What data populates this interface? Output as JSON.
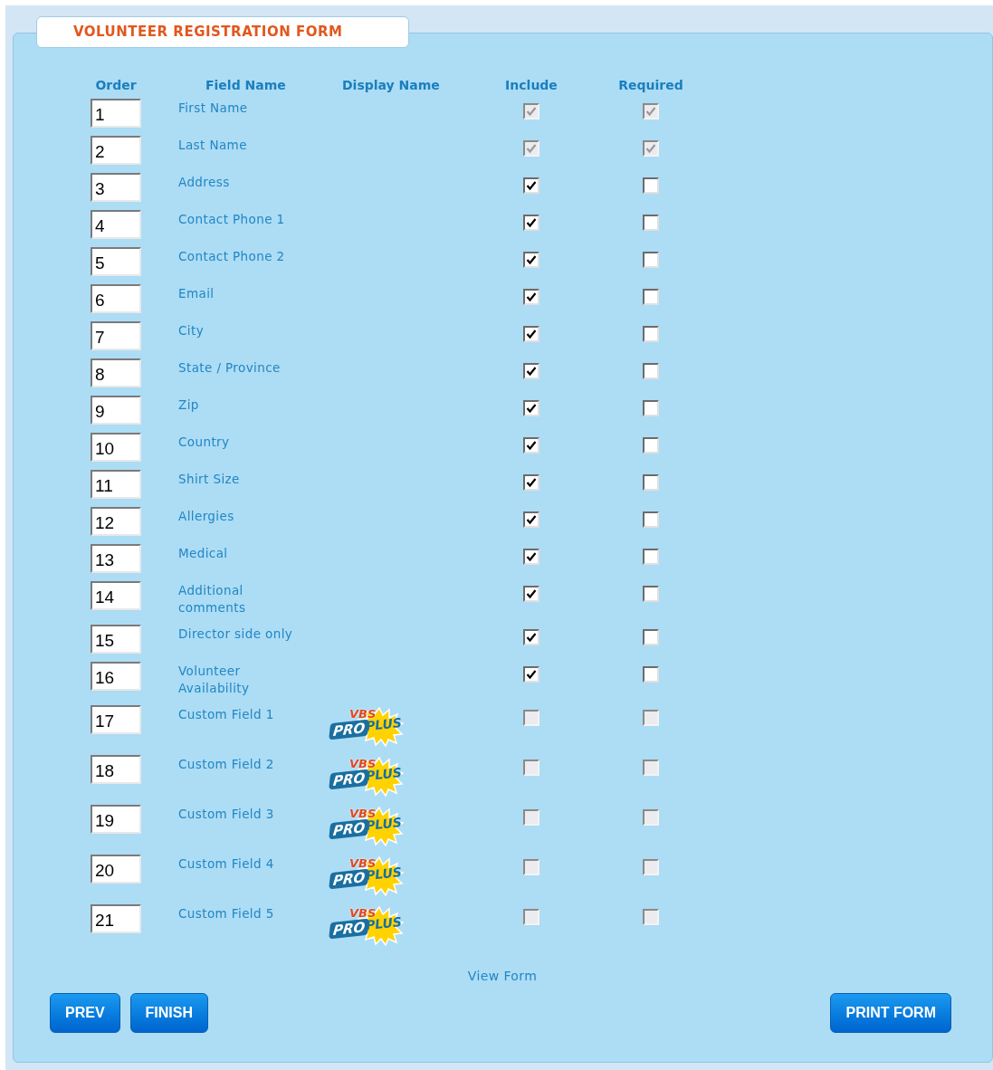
{
  "form_title": "VOLUNTEER REGISTRATION FORM",
  "columns": [
    "Order",
    "Field Name",
    "Display Name",
    "Include",
    "Required"
  ],
  "rows": [
    {
      "order": "1",
      "field_name": "First Name",
      "include_checked": true,
      "include_disabled": true,
      "required_checked": true,
      "required_disabled": true
    },
    {
      "order": "2",
      "field_name": "Last Name",
      "include_checked": true,
      "include_disabled": true,
      "required_checked": true,
      "required_disabled": true
    },
    {
      "order": "3",
      "field_name": "Address",
      "include_checked": true,
      "include_disabled": false,
      "required_checked": false,
      "required_disabled": false
    },
    {
      "order": "4",
      "field_name": "Contact Phone 1",
      "include_checked": true,
      "include_disabled": false,
      "required_checked": false,
      "required_disabled": false
    },
    {
      "order": "5",
      "field_name": "Contact Phone 2",
      "include_checked": true,
      "include_disabled": false,
      "required_checked": false,
      "required_disabled": false
    },
    {
      "order": "6",
      "field_name": "Email",
      "include_checked": true,
      "include_disabled": false,
      "required_checked": false,
      "required_disabled": false
    },
    {
      "order": "7",
      "field_name": "City",
      "include_checked": true,
      "include_disabled": false,
      "required_checked": false,
      "required_disabled": false
    },
    {
      "order": "8",
      "field_name": "State / Province",
      "include_checked": true,
      "include_disabled": false,
      "required_checked": false,
      "required_disabled": false
    },
    {
      "order": "9",
      "field_name": "Zip",
      "include_checked": true,
      "include_disabled": false,
      "required_checked": false,
      "required_disabled": false
    },
    {
      "order": "10",
      "field_name": "Country",
      "include_checked": true,
      "include_disabled": false,
      "required_checked": false,
      "required_disabled": false
    },
    {
      "order": "11",
      "field_name": "Shirt Size",
      "include_checked": true,
      "include_disabled": false,
      "required_checked": false,
      "required_disabled": false
    },
    {
      "order": "12",
      "field_name": "Allergies",
      "include_checked": true,
      "include_disabled": false,
      "required_checked": false,
      "required_disabled": false
    },
    {
      "order": "13",
      "field_name": "Medical",
      "include_checked": true,
      "include_disabled": false,
      "required_checked": false,
      "required_disabled": false
    },
    {
      "order": "14",
      "field_name": "Additional comments",
      "include_checked": true,
      "include_disabled": false,
      "required_checked": false,
      "required_disabled": false
    },
    {
      "order": "15",
      "field_name": "Director side only",
      "include_checked": true,
      "include_disabled": false,
      "required_checked": false,
      "required_disabled": false
    },
    {
      "order": "16",
      "field_name": "Volunteer Availability",
      "include_checked": true,
      "include_disabled": false,
      "required_checked": false,
      "required_disabled": false
    },
    {
      "order": "17",
      "field_name": "Custom Field 1",
      "badge": {
        "top": "VBS",
        "left": "PRO",
        "right": "PLUS"
      },
      "include_checked": false,
      "include_disabled": true,
      "required_checked": false,
      "required_disabled": true
    },
    {
      "order": "18",
      "field_name": "Custom Field 2",
      "badge": {
        "top": "VBS",
        "left": "PRO",
        "right": "PLUS"
      },
      "include_checked": false,
      "include_disabled": true,
      "required_checked": false,
      "required_disabled": true
    },
    {
      "order": "19",
      "field_name": "Custom Field 3",
      "badge": {
        "top": "VBS",
        "left": "PRO",
        "right": "PLUS"
      },
      "include_checked": false,
      "include_disabled": true,
      "required_checked": false,
      "required_disabled": true
    },
    {
      "order": "20",
      "field_name": "Custom Field 4",
      "badge": {
        "top": "VBS",
        "left": "PRO",
        "right": "PLUS"
      },
      "include_checked": false,
      "include_disabled": true,
      "required_checked": false,
      "required_disabled": true
    },
    {
      "order": "21",
      "field_name": "Custom Field 5",
      "badge": {
        "top": "VBS",
        "left": "PRO",
        "right": "PLUS"
      },
      "include_checked": false,
      "include_disabled": true,
      "required_checked": false,
      "required_disabled": true
    }
  ],
  "view_form_link": "View Form",
  "left_buttons": [
    "PREV",
    "FINISH"
  ],
  "right_button": "PRINT FORM"
}
